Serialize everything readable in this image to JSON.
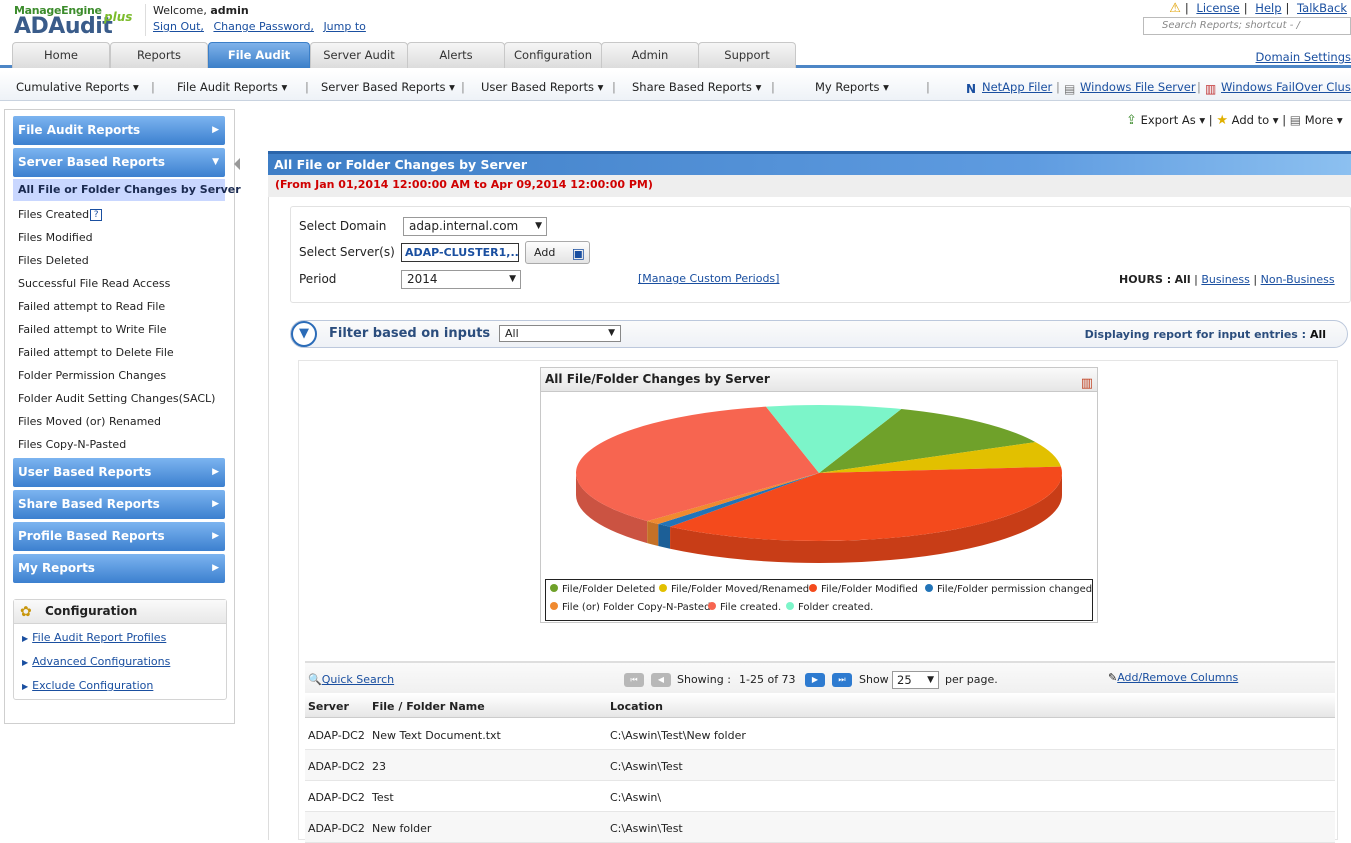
{
  "brand": {
    "company": "ManageEngine",
    "product": "ADAudit",
    "plus": "plus"
  },
  "welcome": {
    "prefix": "Welcome,",
    "user": "admin"
  },
  "top_links": [
    "Sign Out,",
    "Change Password,",
    "Jump to"
  ],
  "right_links": [
    "License",
    "Help",
    "TalkBack"
  ],
  "search": {
    "placeholder": "Search Reports; shortcut - /"
  },
  "tabs": [
    "Home",
    "Reports",
    "File Audit",
    "Server Audit",
    "Alerts",
    "Configuration",
    "Admin",
    "Support"
  ],
  "active_tab": "File Audit",
  "domain_settings": "Domain Settings",
  "subnav": {
    "items": [
      "Cumulative Reports ▾",
      "File Audit Reports ▾",
      "Server Based Reports ▾",
      "User Based Reports ▾",
      "Share Based Reports ▾",
      "My Reports ▾"
    ],
    "ext": [
      "NetApp Filer",
      "Windows File Server",
      "Windows FailOver Cluster"
    ]
  },
  "sidebar": {
    "file_audit_reports": "File Audit Reports",
    "server_based_reports": "Server Based Reports",
    "items": [
      "All File or Folder Changes by Server",
      "Files Created",
      "Files Modified",
      "Files Deleted",
      "Successful File Read Access",
      "Failed attempt to Read File",
      "Failed attempt to Write File",
      "Failed attempt to Delete File",
      "Folder Permission Changes",
      "Folder Audit Setting Changes(SACL)",
      "Files Moved (or) Renamed",
      "Files Copy-N-Pasted"
    ],
    "user_based_reports": "User Based Reports",
    "share_based_reports": "Share Based Reports",
    "profile_based_reports": "Profile Based Reports",
    "my_reports": "My Reports",
    "config_title": "Configuration",
    "config_links": [
      "File Audit Report Profiles",
      "Advanced Configurations",
      "Exclude Configuration"
    ]
  },
  "actions": {
    "export": "Export As ▾",
    "add": "Add to ▾",
    "more": "More ▾"
  },
  "report": {
    "title": "All File or Folder Changes by Server",
    "daterange": "(From Jan 01,2014 12:00:00 AM to Apr 09,2014 12:00:00 PM)"
  },
  "form": {
    "domain_label": "Select Domain",
    "domain_value": "adap.internal.com",
    "server_label": "Select Server(s)",
    "server_value": "ADAP-CLUSTER1,...",
    "add_label": "Add",
    "period_label": "Period",
    "period_value": "2014",
    "manage_link": "[Manage Custom Periods]",
    "hours_label": "HOURS :",
    "hours_all": "All",
    "hours_business": "Business",
    "hours_nonbusiness": "Non-Business"
  },
  "filter": {
    "label": "Filter based on inputs",
    "value": "All",
    "display_label": "Displaying report for input entries :",
    "display_value": "All"
  },
  "chart_data": {
    "type": "pie",
    "title": "All File/Folder Changes by Server",
    "series": [
      {
        "name": "File/Folder Deleted",
        "value": 12,
        "color": "#6fa12a"
      },
      {
        "name": "File/Folder Moved/Renamed",
        "value": 6,
        "color": "#e2c000"
      },
      {
        "name": "File/Folder Modified",
        "value": 37,
        "color": "#f44a1c"
      },
      {
        "name": "File/Folder permission changed",
        "value": 1,
        "color": "#2274b8"
      },
      {
        "name": "File (or) Folder Copy-N-Pasted",
        "value": 1,
        "color": "#f08a30"
      },
      {
        "name": "File created.",
        "value": 34,
        "color": "#f76550"
      },
      {
        "name": "Folder created.",
        "value": 9,
        "color": "#7cf5c9"
      }
    ],
    "legend": "bottom"
  },
  "grid": {
    "quick_search": "Quick Search",
    "showing_label": "Showing :",
    "showing_range": "1-25 of 73",
    "show_label": "Show",
    "page_size": "25",
    "per_page": "per page.",
    "add_remove": "Add/Remove Columns",
    "columns": [
      "Server",
      "File / Folder Name",
      "Location"
    ],
    "rows": [
      [
        "ADAP-DC2",
        "New Text Document.txt",
        "C:\\Aswin\\Test\\New folder"
      ],
      [
        "ADAP-DC2",
        "23",
        "C:\\Aswin\\Test"
      ],
      [
        "ADAP-DC2",
        "Test",
        "C:\\Aswin\\"
      ],
      [
        "ADAP-DC2",
        "New folder",
        "C:\\Aswin\\Test"
      ]
    ]
  }
}
